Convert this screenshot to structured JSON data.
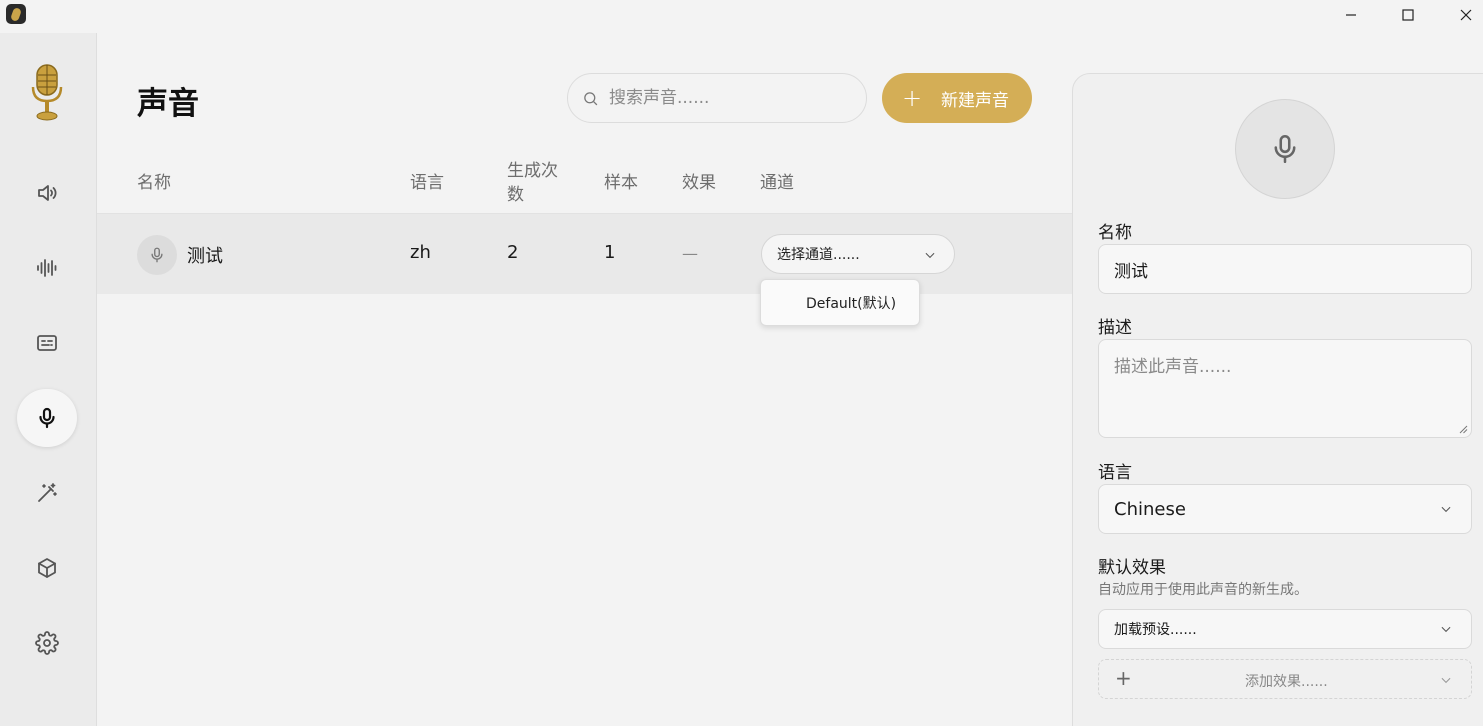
{
  "window": {
    "minimize_icon": "minimize-icon",
    "maximize_icon": "maximize-icon",
    "close_icon": "close-icon"
  },
  "sidebar": {
    "items": [
      {
        "name": "speaker-icon",
        "active": false
      },
      {
        "name": "waveform-icon",
        "active": false
      },
      {
        "name": "subtitles-icon",
        "active": false
      },
      {
        "name": "microphone-icon",
        "active": true
      },
      {
        "name": "magic-wand-icon",
        "active": false
      },
      {
        "name": "cube-icon",
        "active": false
      },
      {
        "name": "gear-icon",
        "active": false
      }
    ]
  },
  "header": {
    "title": "声音",
    "search_placeholder": "搜索声音......",
    "new_button_label": "新建声音"
  },
  "table": {
    "columns": {
      "name": "名称",
      "language": "语言",
      "generations_line1": "生成次",
      "generations_line2": "数",
      "samples": "样本",
      "effects": "效果",
      "channel": "通道"
    },
    "rows": [
      {
        "name": "测试",
        "language": "zh",
        "generations": "2",
        "samples": "1",
        "effects": "—",
        "channel_placeholder": "选择通道......"
      }
    ],
    "channel_dropdown_options": [
      "Default(默认)"
    ]
  },
  "panel": {
    "name_label": "名称",
    "name_value": "测试",
    "description_label": "描述",
    "description_placeholder": "描述此声音......",
    "language_label": "语言",
    "language_value": "Chinese",
    "effects_label": "默认效果",
    "effects_hint": "自动应用于使用此声音的新生成。",
    "preset_placeholder": "加载预设......",
    "add_effect_label": "添加效果......"
  },
  "colors": {
    "accent": "#d4ae56",
    "background": "#f3f3f3",
    "sidebar": "#ebebeb"
  }
}
